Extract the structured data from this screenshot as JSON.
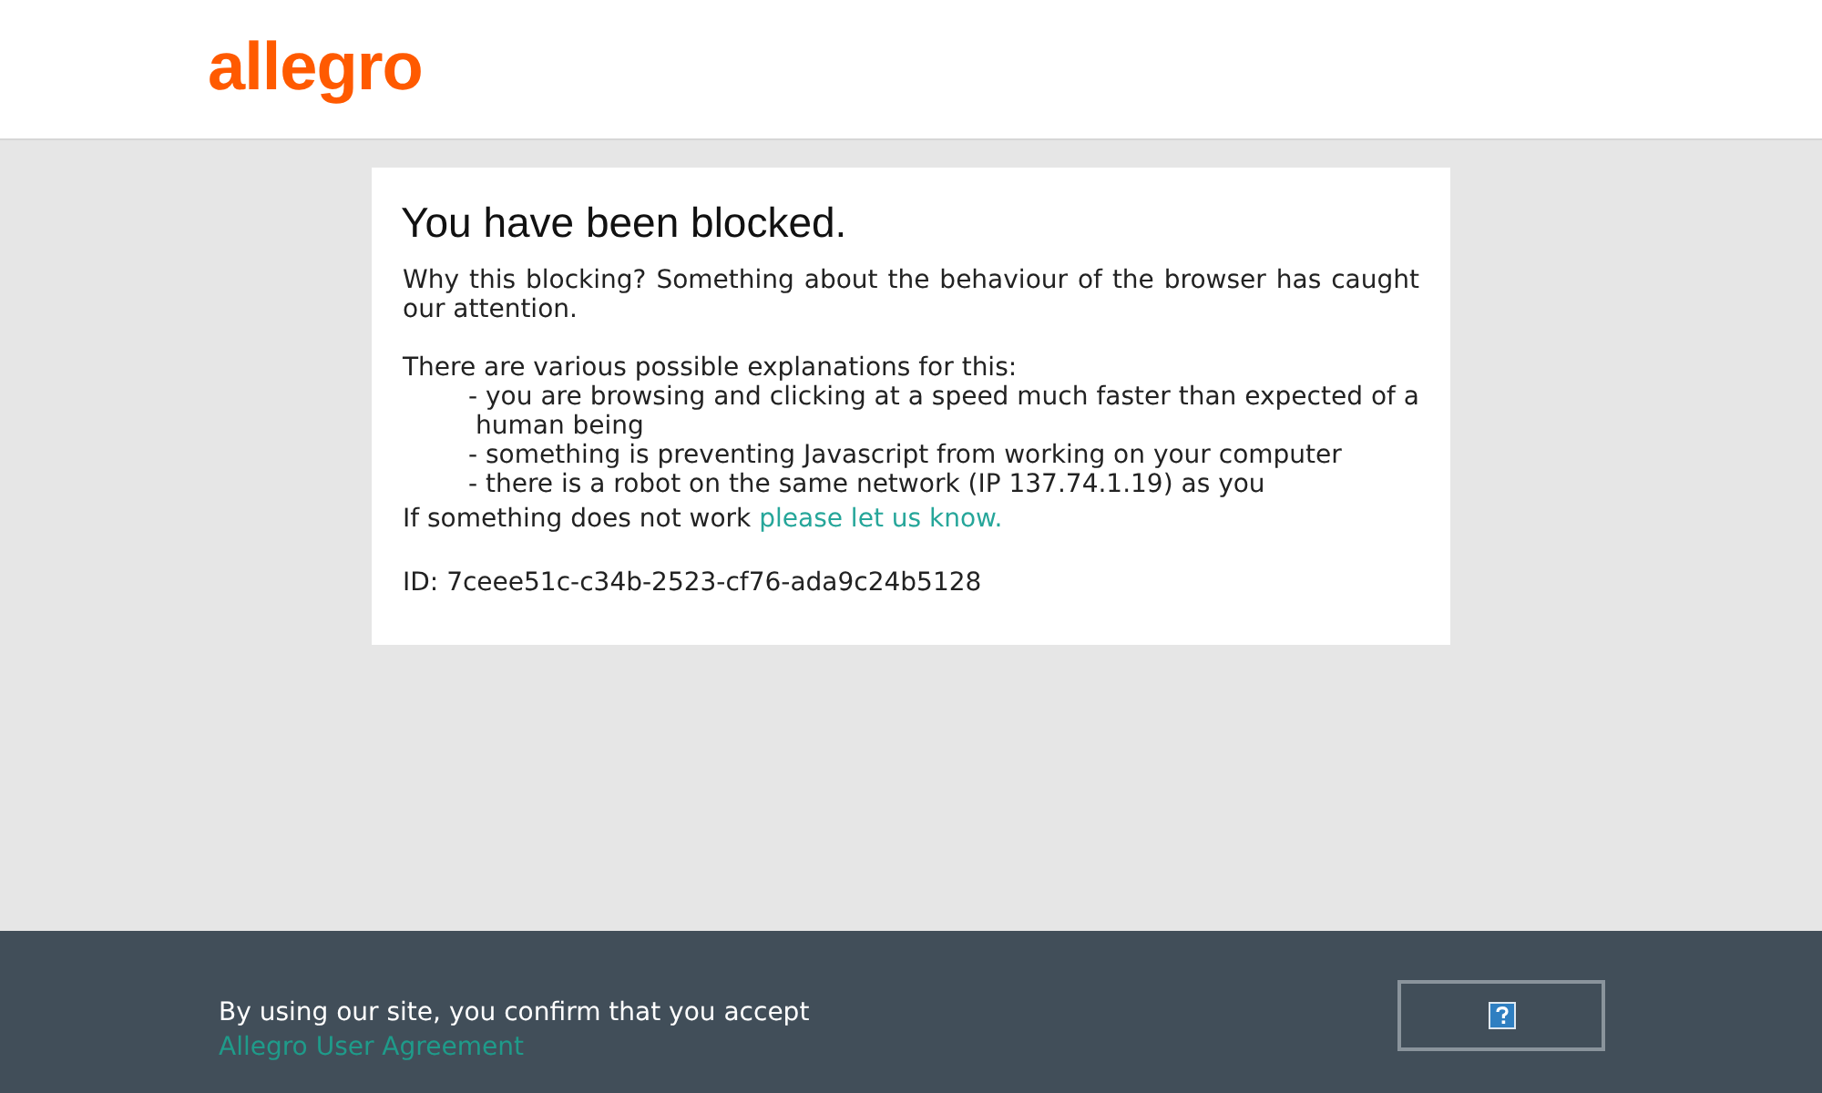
{
  "header": {
    "logo": "allegro"
  },
  "notice": {
    "title": "You have been blocked.",
    "intro": "Why this blocking? Something about the behaviour of the browser has caught our attention.",
    "explanations_heading": "There are various possible explanations for this:",
    "explanations": [
      "- you are browsing and clicking at a speed much faster than expected of a human being",
      "- something is preventing Javascript from working on your computer",
      "- there is a robot on the same network (IP 137.74.1.19) as you"
    ],
    "contact": {
      "text": "If something does not work",
      "link": "please let us know."
    },
    "id": "ID: 7ceee51c-c34b-2523-cf76-ada9c24b5128"
  },
  "footer": {
    "consent": {
      "text": "By using our site, you confirm that you accept",
      "link": "Allegro User Agreement"
    }
  }
}
